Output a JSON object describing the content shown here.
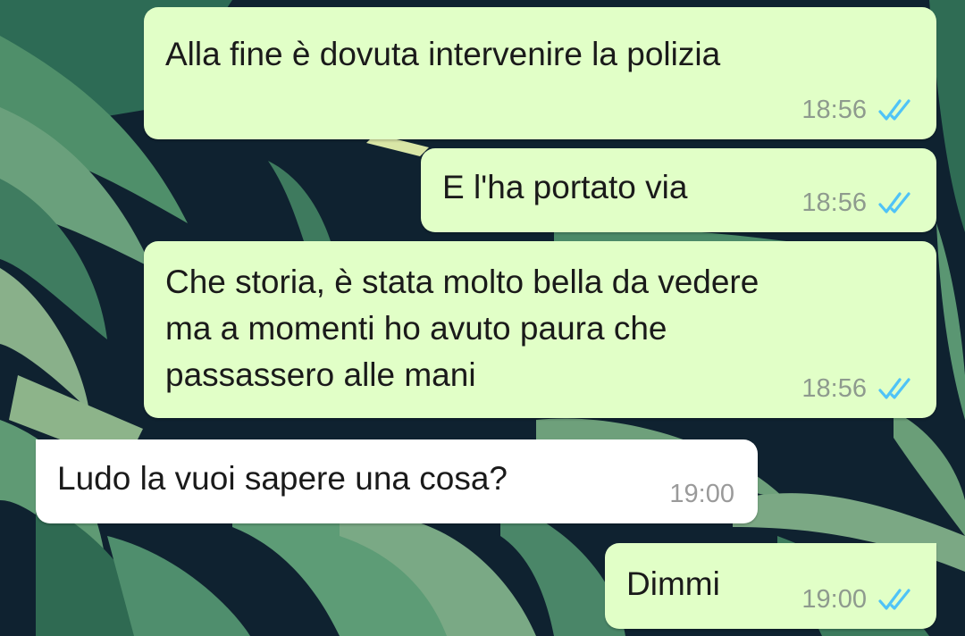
{
  "theme": {
    "outgoing_bubble": "#e1ffc7",
    "incoming_bubble": "#ffffff",
    "read_tick_color": "#4fc3f7"
  },
  "messages": [
    {
      "direction": "outgoing",
      "text": "Alla fine è dovuta intervenire la polizia",
      "time": "18:56",
      "status": "read-double-tick-icon"
    },
    {
      "direction": "outgoing",
      "text": "E l'ha portato via",
      "time": "18:56",
      "status": "read-double-tick-icon"
    },
    {
      "direction": "outgoing",
      "text": "Che storia, è stata molto bella da vedere\nma a momenti ho avuto paura che\npassassero alle mani",
      "time": "18:56",
      "status": "read-double-tick-icon"
    },
    {
      "direction": "incoming",
      "text": "Ludo la vuoi sapere una cosa?",
      "time": "19:00"
    },
    {
      "direction": "outgoing",
      "text": "Dimmi",
      "time": "19:00",
      "status": "read-double-tick-icon"
    }
  ]
}
